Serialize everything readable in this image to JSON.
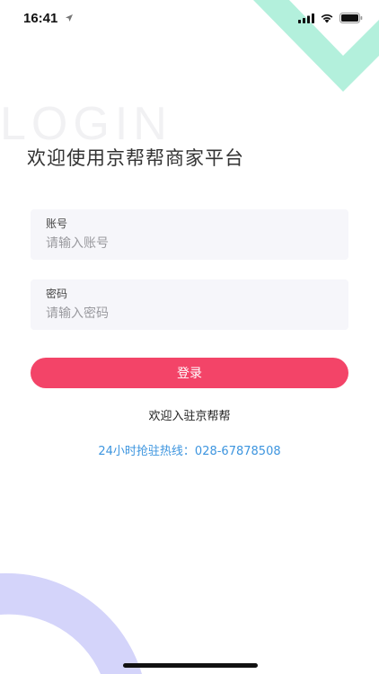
{
  "status_bar": {
    "time": "16:41",
    "icons": [
      "location-arrow-icon",
      "cellular-signal-icon",
      "wifi-icon",
      "battery-icon"
    ]
  },
  "watermark": "LOGIN",
  "title": "欢迎使用京帮帮商家平台",
  "account": {
    "label": "账号",
    "placeholder": "请输入账号",
    "value": ""
  },
  "password": {
    "label": "密码",
    "placeholder": "请输入密码",
    "value": ""
  },
  "login_button": "登录",
  "join_link": "欢迎入驻京帮帮",
  "hotline": "24小时抢驻热线：028-67878508",
  "colors": {
    "accent": "#f34468",
    "link": "#3d95df",
    "deco_top": "#b3f0dc",
    "deco_bottom": "#d4d4fa",
    "field_bg": "#f6f6fa"
  }
}
